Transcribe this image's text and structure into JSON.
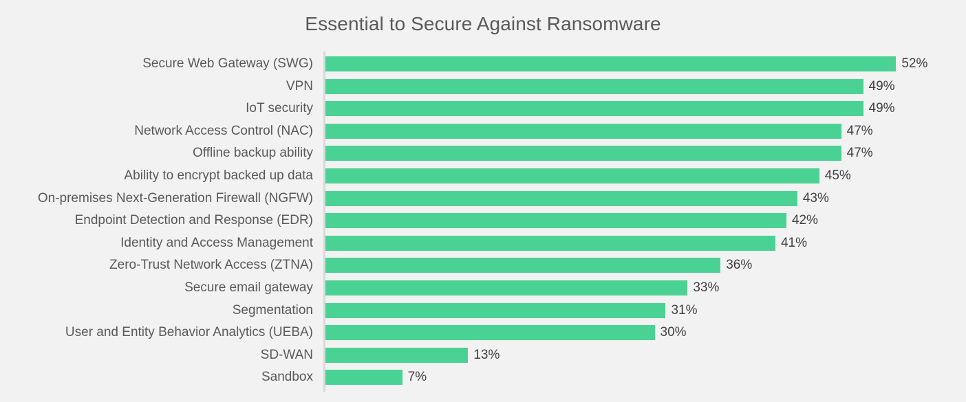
{
  "chart_data": {
    "type": "bar",
    "orientation": "horizontal",
    "title": "Essential to Secure Against Ransomware",
    "subtitle": "",
    "xlabel": "",
    "ylabel": "",
    "xlim": [
      0,
      52
    ],
    "grid": false,
    "legend": null,
    "value_suffix": "%",
    "categories": [
      "Secure Web Gateway (SWG)",
      "VPN",
      "IoT security",
      "Network Access Control (NAC)",
      "Offline backup ability",
      "Ability to encrypt backed up data",
      "On-premises Next-Generation Firewall (NGFW)",
      "Endpoint Detection and Response (EDR)",
      "Identity and Access Management",
      "Zero-Trust Network Access (ZTNA)",
      "Secure email gateway",
      "Segmentation",
      "User and Entity Behavior Analytics (UEBA)",
      "SD-WAN",
      "Sandbox"
    ],
    "values": [
      52,
      49,
      49,
      47,
      47,
      45,
      43,
      42,
      41,
      36,
      33,
      31,
      30,
      13,
      7
    ],
    "value_labels": [
      "52%",
      "49%",
      "49%",
      "47%",
      "47%",
      "45%",
      "43%",
      "42%",
      "41%",
      "36%",
      "33%",
      "31%",
      "30%",
      "13%",
      "7%"
    ],
    "series": [
      {
        "name": "Essential to Secure Against Ransomware",
        "values": [
          52,
          49,
          49,
          47,
          47,
          45,
          43,
          42,
          41,
          36,
          33,
          31,
          30,
          13,
          7
        ]
      }
    ]
  },
  "style": {
    "background_color": "#f2f2f2",
    "bar_color": "#4ad295",
    "title_color": "#595959",
    "category_label_color": "#595959",
    "value_label_color": "#404040",
    "axis_line_color": "#d9d9d9"
  }
}
